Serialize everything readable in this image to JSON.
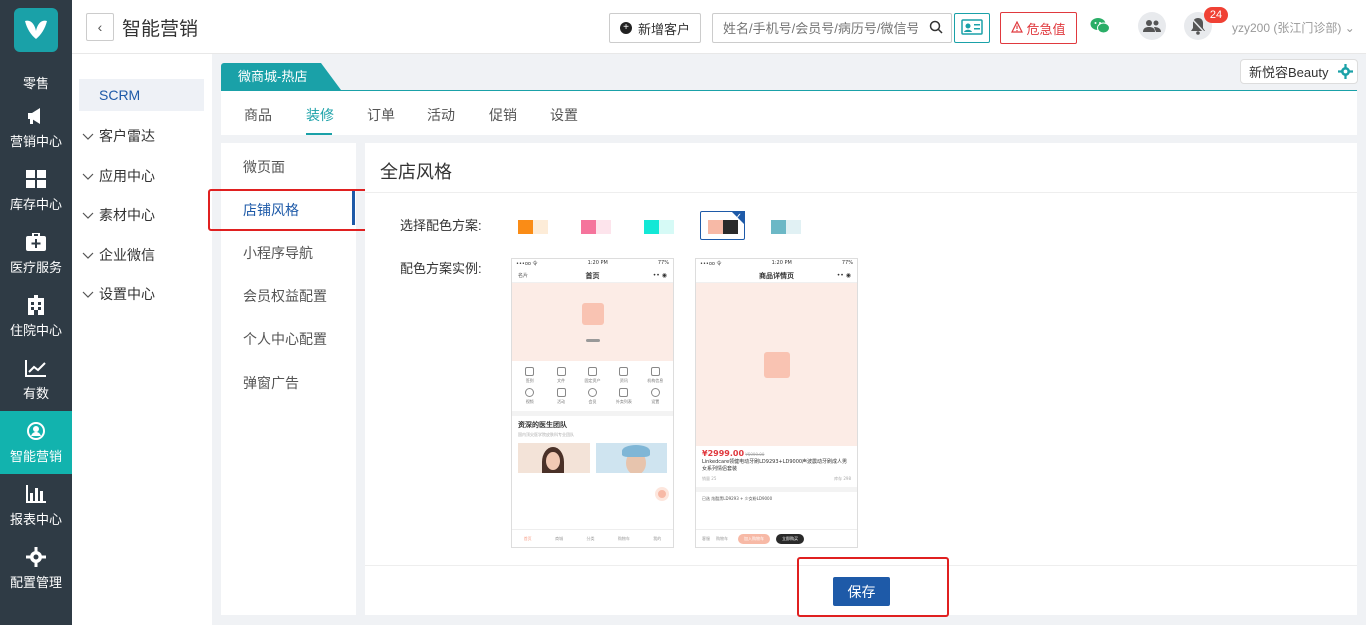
{
  "header": {
    "title": "智能营销",
    "new_customer_label": "新增客户",
    "search_placeholder": "姓名/手机号/会员号/病历号/微信号",
    "danger_label": "危急值",
    "notification_count": "24",
    "user": "yzy200 (张江门诊部)"
  },
  "leftnav": {
    "items": [
      {
        "label": "零售",
        "icon": "retail-icon"
      },
      {
        "label": "营销中心",
        "icon": "megaphone-icon"
      },
      {
        "label": "库存中心",
        "icon": "grid-icon"
      },
      {
        "label": "医疗服务",
        "icon": "medical-kit-icon"
      },
      {
        "label": "住院中心",
        "icon": "hospital-icon"
      },
      {
        "label": "有数",
        "icon": "trend-chart-icon"
      },
      {
        "label": "智能营销",
        "icon": "smart-marketing-icon"
      },
      {
        "label": "报表中心",
        "icon": "bar-chart-icon"
      },
      {
        "label": "配置管理",
        "icon": "gear-icon"
      }
    ],
    "active_index": 6
  },
  "subnav": {
    "active": "SCRM",
    "groups": [
      "客户雷达",
      "应用中心",
      "素材中心",
      "企业微信",
      "设置中心"
    ]
  },
  "shop": {
    "tab_label": "微商城-热店",
    "brand": "新悦容Beauty",
    "tabs": [
      "商品",
      "装修",
      "订单",
      "活动",
      "促销",
      "设置"
    ],
    "active_tab": "装修"
  },
  "decoration_menu": {
    "items": [
      "微页面",
      "店铺风格",
      "小程序导航",
      "会员权益配置",
      "个人中心配置",
      "弹窗广告"
    ],
    "active": "店铺风格"
  },
  "content": {
    "title": "全店风格",
    "scheme_label": "选择配色方案:",
    "example_label": "配色方案实例:",
    "schemes": [
      {
        "primary": "#fa8c16",
        "secondary": "#fdecd8"
      },
      {
        "primary": "#f5749c",
        "secondary": "#fde4ec"
      },
      {
        "primary": "#13e8d6",
        "secondary": "#d6faf6"
      },
      {
        "primary": "#f7b9a6",
        "secondary": "#2a2a2a"
      },
      {
        "primary": "#6cb8c6",
        "secondary": "#e1f1f4"
      }
    ],
    "selected_scheme": 3,
    "save_label": "保存"
  },
  "phone1": {
    "status_left": "•••oo 令",
    "status_time": "1:20 PM",
    "status_right": "77%",
    "corner_label": "名片",
    "title": "首页",
    "grid": [
      "签到",
      "文件",
      "固定资产",
      "资讯",
      "机构信息",
      "视频",
      "活动",
      "会员",
      "外卖列表",
      "设置"
    ],
    "section_title": "资深的医生团队",
    "section_sub": "国内顶尖医学院皮肤科专业团队",
    "tabbar": [
      "首页",
      "商城",
      "分类",
      "购物车",
      "我的"
    ]
  },
  "phone2": {
    "status_left": "•••oo 令",
    "status_time": "1:20 PM",
    "status_right": "77%",
    "title": "商品详情页",
    "price": "¥2999.00",
    "old_price": "¥5999.00",
    "product_name": "Linkedcare领健电动牙刷LD9293+LD9000声波震动牙刷成人男女系列情侣套装",
    "sales": "销量 25",
    "stock": "库存 298",
    "selected": "已选  炫酷黑LD9293 + 少女粉LD9000",
    "btn_cart": "加入购物车",
    "btn_buy": "立即购买",
    "tab_service": "客服",
    "tab_cart": "购物车"
  }
}
